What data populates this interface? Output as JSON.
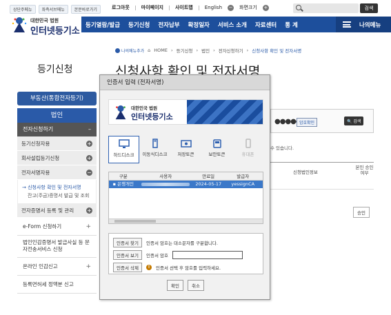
{
  "top": {
    "links": [
      "상단주메뉴",
      "좌측서브메뉴",
      "본문바로가기"
    ],
    "util": [
      "로그아웃",
      "마이페이지",
      "사이트맵",
      "English"
    ],
    "font_label": "화면크기",
    "search_button": "검색"
  },
  "logo": {
    "sub": "대한민국 법원",
    "main": "인터넷등기소"
  },
  "gnb": {
    "items": [
      "등기열람/발급",
      "등기신청",
      "전자납부",
      "확정일자",
      "서비스 소개",
      "자료센터",
      "통 계"
    ],
    "mymenu": "나의메뉴"
  },
  "breadcrumb": {
    "fav": "나의메뉴추가",
    "path": [
      "HOME",
      "등기신청",
      "법인",
      "전자신청하기"
    ],
    "current": "신청사항 확인 및 전자서명"
  },
  "left_title": "등기신청",
  "page_title": "신청사항 확인 및 전자서명",
  "sidebar": {
    "realty": "부동산(통합전자등기)",
    "corp": "법인",
    "section": "전자신청하기",
    "section_mark": "–",
    "items1": [
      "등기신청자용",
      "회사설립등기신청",
      "전자서명자용"
    ],
    "sub_active": "신청사항 확인 및 전자서명",
    "sub_other": "잔고(주금)증명서 발급 및 조회",
    "item_cert": "전자증명서 등록 및 관리",
    "eform": "e-Form 신청하기",
    "two_line": "법인인감증명서 발급사실 등 문자전송서비스 신청",
    "online": "온라인 인감신고",
    "tax": "등록면허세 정액분 신고"
  },
  "bg": {
    "pw_dots": "●●●●●",
    "confirm_btn": "암호확인",
    "search_btn": "검색",
    "notice": "수 있습니다.",
    "col1": "신청법인정보",
    "col2": "본인 승인여부",
    "btn": "승인"
  },
  "modal": {
    "title": "인증서 입력 (전자서명)",
    "banner_sub": "대한민국 법원",
    "banner_main": "인터넷등기소",
    "devices": [
      "하드디스크",
      "이동식디스크",
      "저장토큰",
      "보안토큰",
      "휴대폰"
    ],
    "headers": [
      "구분",
      "사용자",
      "만료일",
      "발급자"
    ],
    "row": {
      "type": "은행개인",
      "expiry": "2024-05-17",
      "issuer": "yessignCA"
    },
    "find_btn": "인증서 찾기",
    "find_note": "인증서 암호는 대소문자를 구분합니다.",
    "view_btn": "인증서 보기",
    "pw_label": "인증서 암호",
    "del_btn": "인증서 삭제",
    "warn_note": "인증서 선택 후 암호를 입력하세요.",
    "ok": "확인",
    "cancel": "취소"
  }
}
